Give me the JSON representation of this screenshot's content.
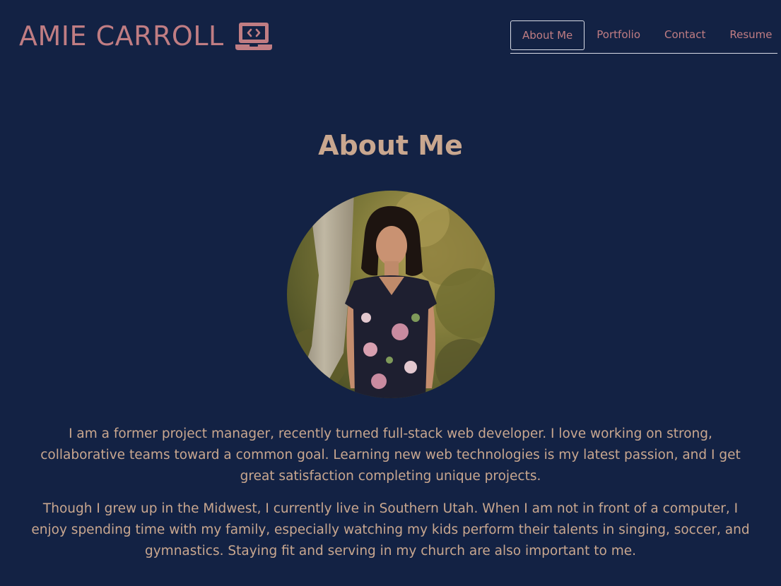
{
  "brand": {
    "name": "AMIE CARROLL",
    "icon": "laptop-code-icon",
    "color": "#c07d83"
  },
  "nav": {
    "items": [
      {
        "label": "About Me",
        "active": true
      },
      {
        "label": "Portfolio",
        "active": false
      },
      {
        "label": "Contact",
        "active": false
      },
      {
        "label": "Resume",
        "active": false
      }
    ]
  },
  "main": {
    "title": "About Me",
    "paragraphs": [
      "I am a former project manager, recently turned full-stack web developer. I love working on strong, collaborative teams toward a common goal. Learning new web technologies is my latest passion, and I get great satisfaction completing unique projects.",
      "Though I grew up in the Midwest, I currently live in Southern Utah. When I am not in front of a computer, I enjoy spending time with my family, especially watching my kids perform their talents in singing, soccer, and gymnastics. Staying fit and serving in my church are also important to me."
    ]
  },
  "colors": {
    "background": "#132244",
    "accent": "#c07d83",
    "text": "#c9a78f"
  }
}
